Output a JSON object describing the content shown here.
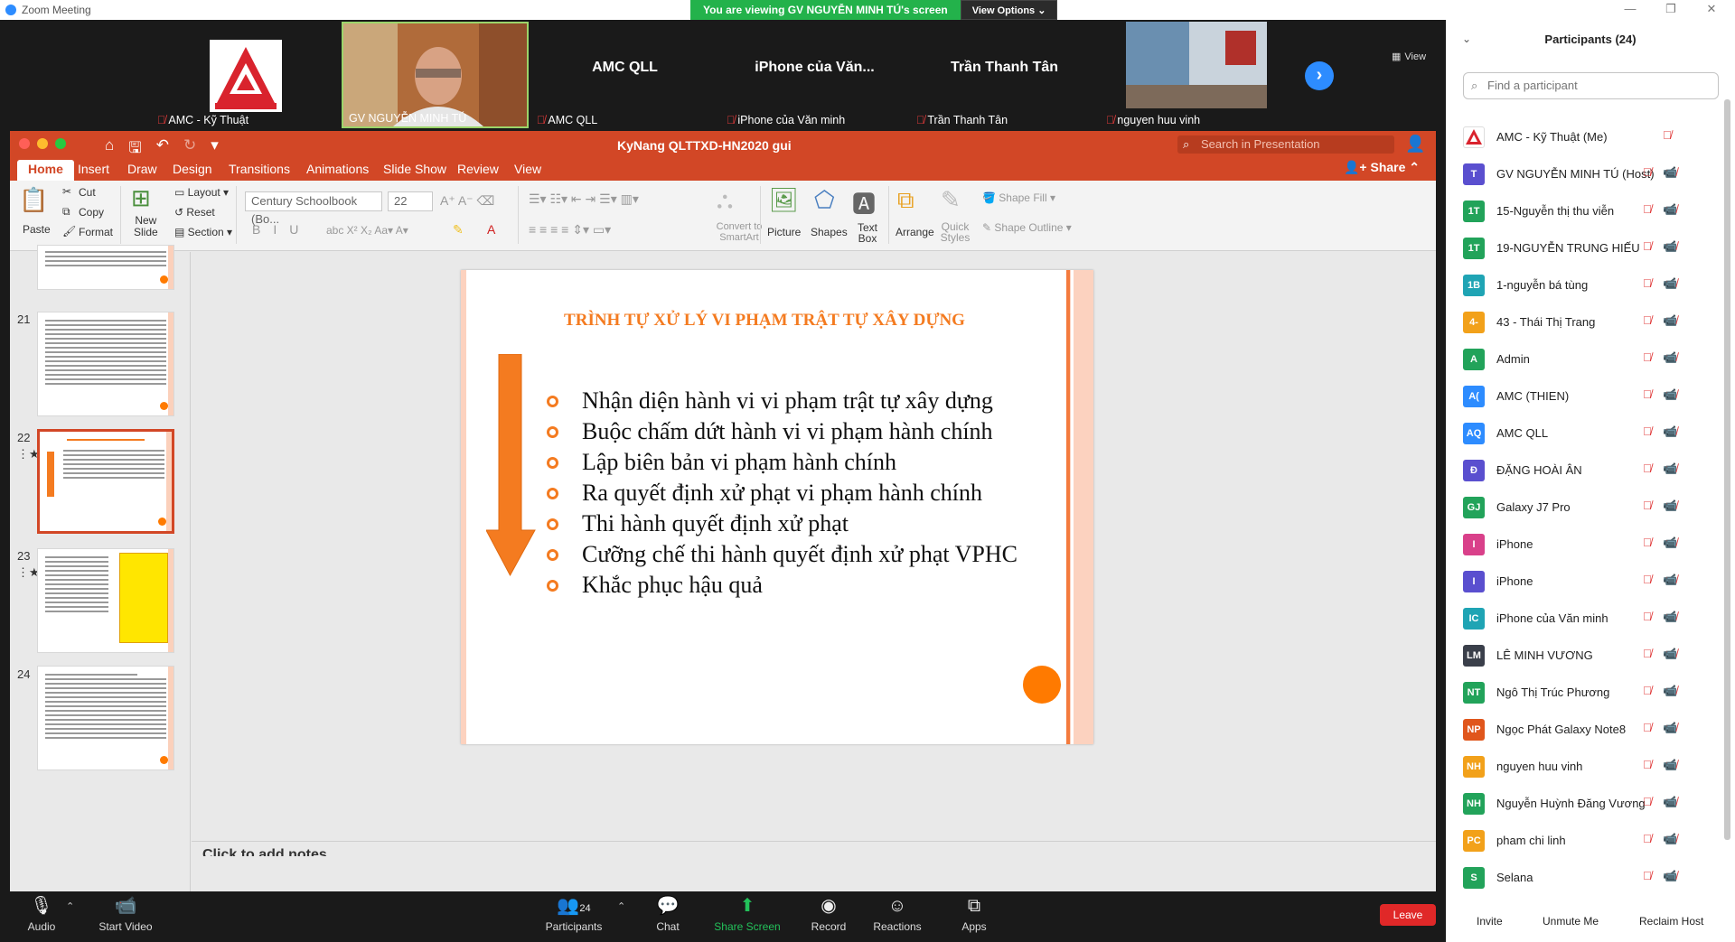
{
  "window": {
    "title": "Zoom Meeting"
  },
  "banner": {
    "viewing": "You are viewing GV NGUYỄN MINH TÚ's screen",
    "options": "View Options"
  },
  "view_label": "View",
  "videos": [
    {
      "name": "AMC - Kỹ Thuật",
      "label": "",
      "muted": true
    },
    {
      "name": "GV NGUYỄN MINH TÚ",
      "label": "",
      "muted": false
    },
    {
      "name": "AMC QLL",
      "label": "AMC QLL",
      "muted": true
    },
    {
      "name": "iPhone của Văn minh",
      "label": "iPhone  của  Văn...",
      "muted": true
    },
    {
      "name": "Trần Thanh Tân",
      "label": "Trần Thanh Tân",
      "muted": true
    },
    {
      "name": "nguyen huu vinh",
      "label": "",
      "muted": true
    }
  ],
  "ppt": {
    "doc_title": "KyNang QLTTXD-HN2020 gui",
    "search_placeholder": "Search in Presentation",
    "tabs": [
      "Home",
      "Insert",
      "Draw",
      "Design",
      "Transitions",
      "Animations",
      "Slide Show",
      "Review",
      "View"
    ],
    "share": "Share",
    "ribbon": {
      "paste": "Paste",
      "cut": "Cut",
      "copy": "Copy",
      "format": "Format",
      "new_slide": "New\nSlide",
      "layout": "Layout",
      "reset": "Reset",
      "section": "Section",
      "font": "Century Schoolbook (Bo...",
      "size": "22",
      "convert": "Convert to SmartArt",
      "picture": "Picture",
      "shapes": "Shapes",
      "textbox": "Text Box",
      "arrange": "Arrange",
      "quick_styles": "Quick Styles",
      "shape_fill": "Shape Fill",
      "shape_outline": "Shape Outline"
    },
    "thumbs": [
      {
        "num": "21",
        "starred": false
      },
      {
        "num": "22",
        "starred": true
      },
      {
        "num": "23",
        "starred": true
      },
      {
        "num": "24",
        "starred": false
      }
    ],
    "slide": {
      "title": "TRÌNH TỰ XỬ LÝ VI PHẠM TRẬT TỰ XÂY DỰNG",
      "bullets": [
        "Nhận diện hành vi vi phạm trật tự xây dựng",
        "Buộc chấm dứt hành vi vi phạm hành chính",
        "Lập biên bản vi phạm hành chính",
        "Ra quyết định xử phạt vi phạm hành chính",
        "Thi hành quyết định xử phạt",
        "Cưỡng chế thi hành quyết định xử phạt VPHC",
        "Khắc phục hậu quả"
      ]
    },
    "notes_placeholder": "Click to add notes"
  },
  "participants": {
    "header": "Participants (24)",
    "search_placeholder": "Find a participant",
    "list": [
      {
        "initials": "",
        "name": "AMC - Kỹ Thuật (Me)",
        "color": "#ffffff"
      },
      {
        "initials": "T",
        "name": "GV NGUYỄN MINH TÚ (Host)",
        "color": "#5a4fcf"
      },
      {
        "initials": "1T",
        "name": "15-Nguyễn thị thu viễn",
        "color": "#22a35a"
      },
      {
        "initials": "1T",
        "name": "19-NGUYỄN TRUNG HIẾU",
        "color": "#22a35a"
      },
      {
        "initials": "1B",
        "name": "1-nguyễn bá tùng",
        "color": "#1fa4b4"
      },
      {
        "initials": "4-",
        "name": "43 - Thái Thị Trang",
        "color": "#f2a11a"
      },
      {
        "initials": "A",
        "name": "Admin",
        "color": "#22a35a"
      },
      {
        "initials": "A(",
        "name": "AMC (THIEN)",
        "color": "#2d8cff"
      },
      {
        "initials": "AQ",
        "name": "AMC QLL",
        "color": "#2d8cff"
      },
      {
        "initials": "Đ",
        "name": "ĐẶNG HOÀI ÂN",
        "color": "#5a4fcf"
      },
      {
        "initials": "GJ",
        "name": "Galaxy J7 Pro",
        "color": "#22a35a"
      },
      {
        "initials": "I",
        "name": "iPhone",
        "color": "#d9408a"
      },
      {
        "initials": "I",
        "name": "iPhone",
        "color": "#5a4fcf"
      },
      {
        "initials": "IC",
        "name": "iPhone của Văn minh",
        "color": "#1fa4b4"
      },
      {
        "initials": "LM",
        "name": "LÊ MINH VƯƠNG",
        "color": "#3a3f4a"
      },
      {
        "initials": "NT",
        "name": "Ngô Thị Trúc Phương",
        "color": "#22a35a"
      },
      {
        "initials": "NP",
        "name": "Ngọc Phát Galaxy Note8",
        "color": "#e0561c"
      },
      {
        "initials": "NH",
        "name": "nguyen huu vinh",
        "color": "#f2a11a"
      },
      {
        "initials": "NH",
        "name": "Nguyễn Huỳnh Đăng Vương",
        "color": "#22a35a"
      },
      {
        "initials": "PC",
        "name": "pham chi linh",
        "color": "#f2a11a"
      },
      {
        "initials": "S",
        "name": "Selana",
        "color": "#22a35a"
      }
    ],
    "buttons": [
      "Invite",
      "Unmute Me",
      "Reclaim Host"
    ]
  },
  "bottombar": {
    "audio": "Audio",
    "start_video": "Start Video",
    "participants": "Participants",
    "participants_count": "24",
    "chat": "Chat",
    "share_screen": "Share Screen",
    "record": "Record",
    "reactions": "Reactions",
    "apps": "Apps",
    "leave": "Leave"
  }
}
